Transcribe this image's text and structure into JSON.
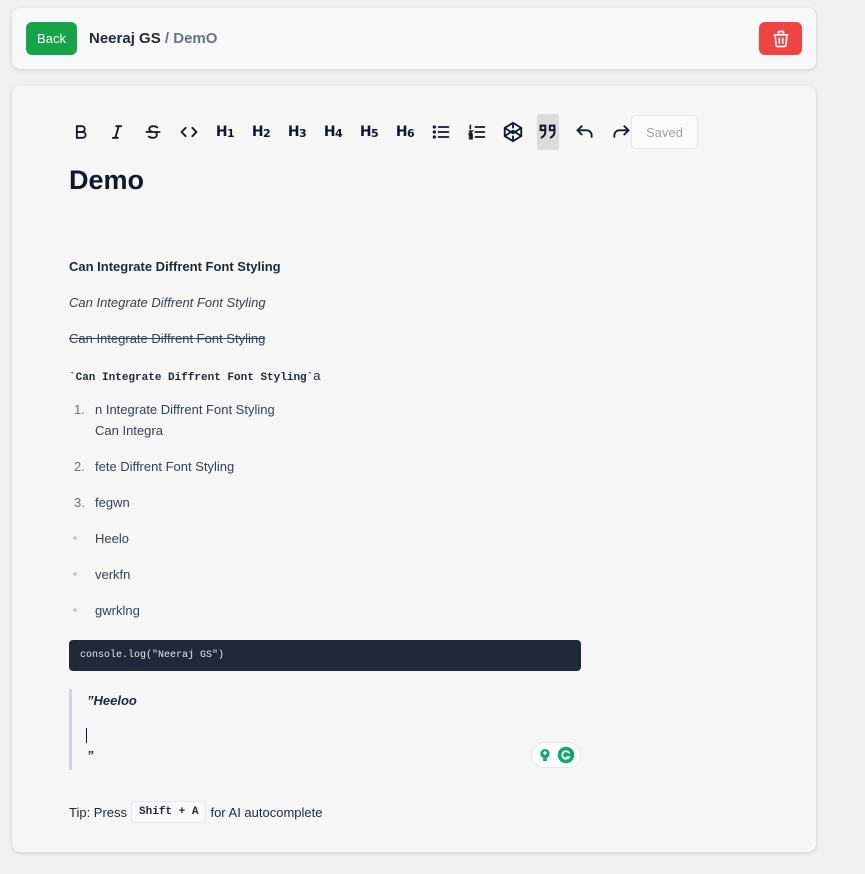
{
  "header": {
    "back_label": "Back",
    "user": "Neeraj GS",
    "separator": "/",
    "document": "DemO",
    "delete_icon": "trash-icon",
    "colors": {
      "back": "#16a34a",
      "delete": "#ef4444"
    }
  },
  "toolbar": {
    "buttons": [
      "bold-icon",
      "italic-icon",
      "strikethrough-icon",
      "code-icon",
      "heading-1",
      "heading-2",
      "heading-3",
      "heading-4",
      "heading-5",
      "heading-6",
      "bullet-list-icon",
      "ordered-list-icon",
      "codeblock-icon",
      "blockquote-icon",
      "undo-icon",
      "redo-icon"
    ],
    "headings": [
      {
        "h": "H",
        "n": "1"
      },
      {
        "h": "H",
        "n": "2"
      },
      {
        "h": "H",
        "n": "3"
      },
      {
        "h": "H",
        "n": "4"
      },
      {
        "h": "H",
        "n": "5"
      },
      {
        "h": "H",
        "n": "6"
      }
    ],
    "active": "blockquote-icon",
    "status": "Saved"
  },
  "document": {
    "title": "Demo",
    "bold_line": "Can Integrate Diffrent Font Styling",
    "italic_line": "Can Integrate Diffrent Font Styling",
    "strike_line": "Can Integrate Diffrent Font Styling",
    "code_line": {
      "tick_open": "`",
      "code": "Can Integrate Diffrent Font Styling",
      "tick_close": "`",
      "trailing": "a"
    },
    "ordered_list": [
      {
        "marker": "1.",
        "lines": [
          "n Integrate Diffrent Font Styling",
          "Can Integra"
        ]
      },
      {
        "marker": "2.",
        "lines": [
          "fete Diffrent Font Styling"
        ]
      },
      {
        "marker": "3.",
        "lines": [
          "fegwn"
        ]
      }
    ],
    "bullet_list": [
      "Heelo",
      "verkfn",
      "gwrklng"
    ],
    "code_block": "console.log(\"Neeraj GS\")",
    "blockquote": {
      "open": "”Heeloo",
      "close": "”"
    }
  },
  "tip": {
    "prefix": "Tip: Press",
    "key": "Shift + A",
    "suffix": "for AI autocomplete"
  }
}
